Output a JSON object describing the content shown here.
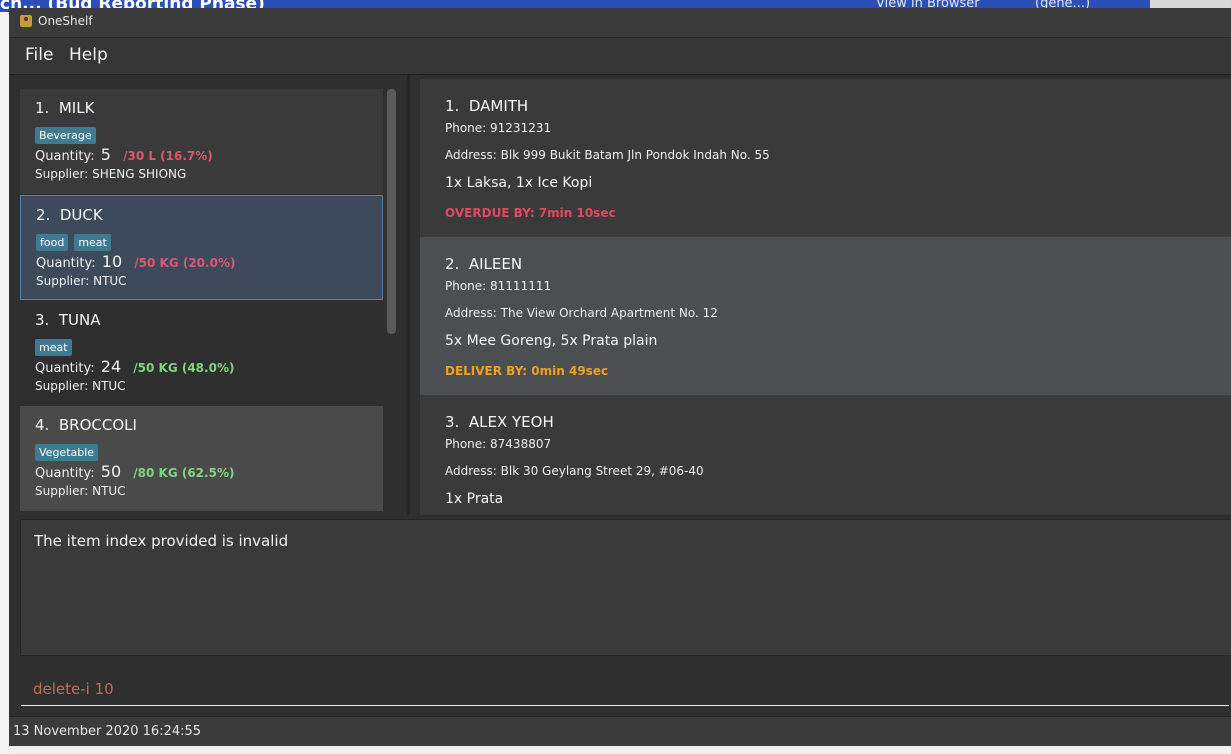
{
  "background_window": {
    "title": "ch... (Bug Reporting Phase)",
    "right_text": "View in Browser",
    "right_text2": "(gene...)"
  },
  "window": {
    "title": "OneShelf"
  },
  "menu": [
    {
      "label": "File"
    },
    {
      "label": "Help"
    }
  ],
  "inventory": [
    {
      "index": "1.",
      "name": "MILK",
      "tags": [
        "Beverage"
      ],
      "quantity_label": "Quantity:",
      "quantity": "5",
      "max": "/30 L (16.7%)",
      "max_color": "#e0566e",
      "supplier": "Supplier: SHENG SHIONG",
      "selected": false
    },
    {
      "index": "2.",
      "name": "DUCK",
      "tags": [
        "food",
        "meat"
      ],
      "quantity_label": "Quantity:",
      "quantity": "10",
      "max": "/50 KG (20.0%)",
      "max_color": "#e0566e",
      "supplier": "Supplier: NTUC",
      "selected": true
    },
    {
      "index": "3.",
      "name": "TUNA",
      "tags": [
        "meat"
      ],
      "quantity_label": "Quantity:",
      "quantity": "24",
      "max": "/50 KG (48.0%)",
      "max_color": "#7ed67e",
      "supplier": "Supplier: NTUC",
      "selected": false
    },
    {
      "index": "4.",
      "name": "BROCCOLI",
      "tags": [
        "Vegetable"
      ],
      "quantity_label": "Quantity:",
      "quantity": "50",
      "max": "/80 KG (62.5%)",
      "max_color": "#7ed67e",
      "supplier": "Supplier: NTUC",
      "selected": false
    }
  ],
  "deliveries": [
    {
      "index": "1.",
      "name": "DAMITH",
      "phone": "Phone: 91231231",
      "address": "Address: Blk 999 Bukit Batam Jln Pondok Indah No. 55",
      "order": "1x Laksa, 1x Ice Kopi",
      "status": "OVERDUE BY: 7min 10sec",
      "status_color": "#e04a5e"
    },
    {
      "index": "2.",
      "name": "AILEEN",
      "phone": "Phone: 81111111",
      "address": "Address: The View Orchard Apartment No. 12",
      "order": "5x Mee Goreng, 5x Prata plain",
      "status": "DELIVER BY: 0min 49sec",
      "status_color": "#f0a020"
    },
    {
      "index": "3.",
      "name": "ALEX YEOH",
      "phone": "Phone: 87438807",
      "address": "Address: Blk 30 Geylang Street 29, #06-40",
      "order": "1x Prata",
      "status": "",
      "status_color": "#f0a020"
    }
  ],
  "result": {
    "text": "The item index provided is invalid"
  },
  "command": {
    "value": "delete-i 10"
  },
  "status_bar": {
    "datetime": "13 November 2020 16:24:55"
  },
  "colors": {
    "tag_bg": "#3e7b91",
    "command_text": "#c9695a",
    "selection_border": "#5c7fa5"
  }
}
